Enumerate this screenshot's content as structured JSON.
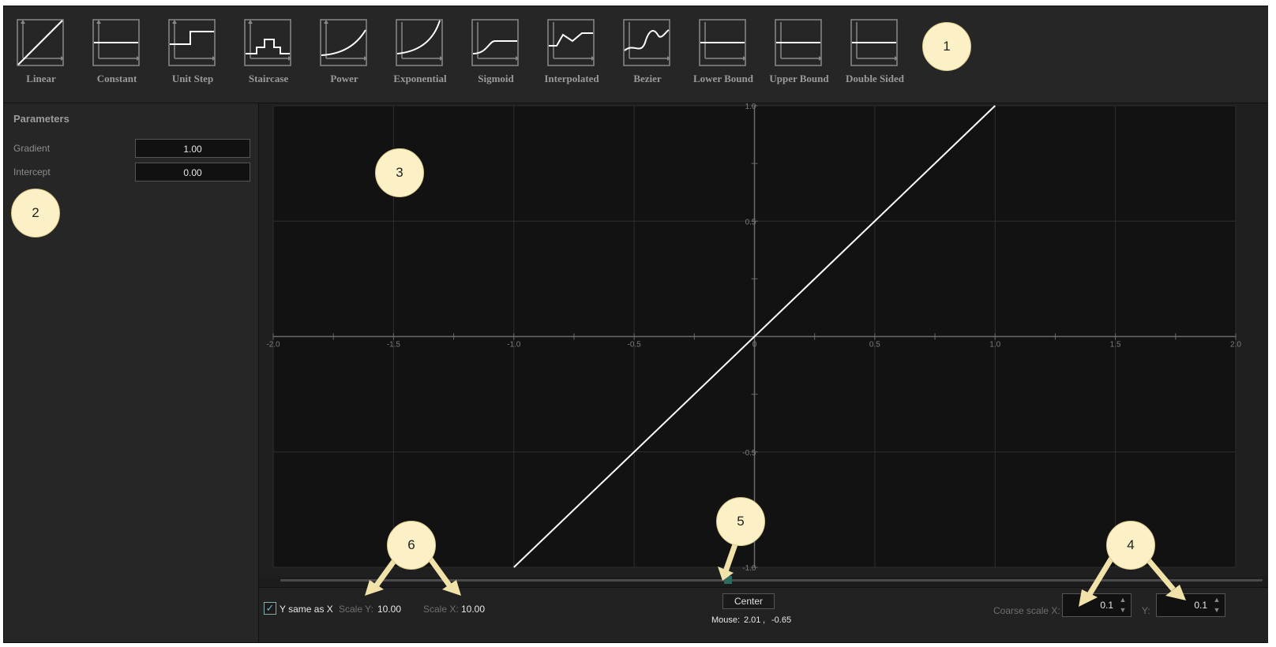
{
  "toolbar": {
    "tools": [
      {
        "label": "Linear",
        "icon": "linear-graph-icon",
        "selected": true
      },
      {
        "label": "Constant",
        "icon": "constant-graph-icon",
        "selected": false
      },
      {
        "label": "Unit Step",
        "icon": "unit-step-graph-icon",
        "selected": false
      },
      {
        "label": "Staircase",
        "icon": "staircase-graph-icon",
        "selected": false
      },
      {
        "label": "Power",
        "icon": "power-graph-icon",
        "selected": false
      },
      {
        "label": "Exponential",
        "icon": "exponential-graph-icon",
        "selected": false
      },
      {
        "label": "Sigmoid",
        "icon": "sigmoid-graph-icon",
        "selected": false
      },
      {
        "label": "Interpolated",
        "icon": "interpolated-graph-icon",
        "selected": false
      },
      {
        "label": "Bezier",
        "icon": "bezier-graph-icon",
        "selected": false
      },
      {
        "label": "Lower Bound",
        "icon": "lower-bound-graph-icon",
        "selected": false
      },
      {
        "label": "Upper Bound",
        "icon": "upper-bound-graph-icon",
        "selected": false
      },
      {
        "label": "Double Sided",
        "icon": "double-sided-graph-icon",
        "selected": false
      }
    ]
  },
  "callouts": [
    "1",
    "2",
    "3",
    "4",
    "5",
    "6"
  ],
  "parameters": {
    "title": "Parameters",
    "fields": [
      {
        "label": "Gradient",
        "value": "1.00"
      },
      {
        "label": "Intercept",
        "value": "0.00"
      }
    ]
  },
  "bottom": {
    "y_same_label": "Y same as X",
    "y_same_checked": true,
    "scale_y_label": "Scale Y:",
    "scale_y_value": "10.00",
    "scale_x_label": "Scale X:",
    "scale_x_value": "10.00",
    "center_label": "Center",
    "mouse_label": "Mouse:",
    "mouse_x": "2.01",
    "mouse_sep": ",",
    "mouse_y": "-0.65",
    "coarse_x_label": "Coarse scale X:",
    "coarse_x_value": "0.1",
    "coarse_y_label": "Y:",
    "coarse_y_value": "0.1"
  },
  "colors": {
    "accent": "#2a5e55",
    "callout": "#fbf0c6",
    "plot_background": "#121212",
    "curve": "#ffffff"
  },
  "chart_data": {
    "type": "line",
    "x_ticks": [
      "-2.0",
      "-1.5",
      "-1.0",
      "-0.5",
      "0",
      "0.5",
      "1.0",
      "1.5",
      "2.0"
    ],
    "y_ticks": [
      "1.0",
      "0.5",
      "-0.5",
      "-1.0"
    ],
    "xlim": [
      -2.0,
      2.0
    ],
    "ylim": [
      -1.0,
      1.0
    ],
    "grid": true,
    "series": [
      {
        "x": [
          -1.0,
          1.0
        ],
        "y": [
          -1.0,
          1.0
        ]
      }
    ]
  }
}
